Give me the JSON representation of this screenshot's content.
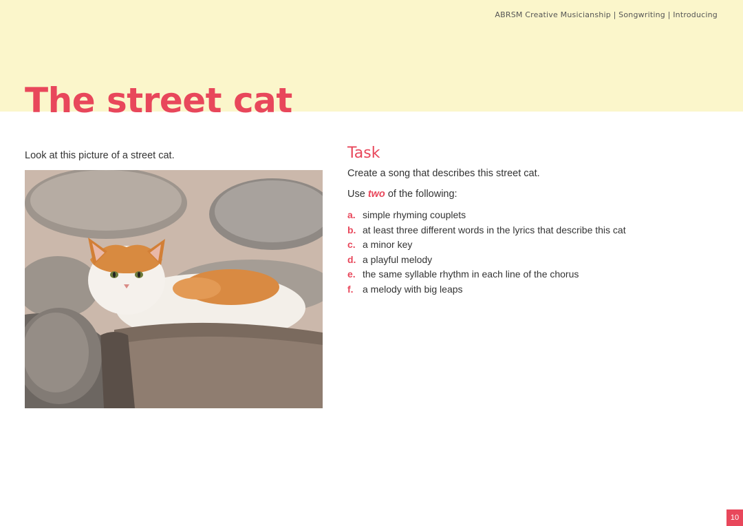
{
  "header": {
    "running_head": "ABRSM Creative Musicianship | Songwriting | Introducing",
    "title": "The street cat"
  },
  "left": {
    "intro": "Look at this picture of a street cat."
  },
  "task": {
    "title": "Task",
    "lead": "Create a song that describes this street cat.",
    "use_prefix": "Use",
    "use_emphasis": "two",
    "use_suffix": "of the following:",
    "options": [
      {
        "letter": "a.",
        "text": "simple rhyming couplets"
      },
      {
        "letter": "b.",
        "text": "at least three different words in the lyrics that describe this cat"
      },
      {
        "letter": "c.",
        "text": "a minor key"
      },
      {
        "letter": "d.",
        "text": "a playful melody"
      },
      {
        "letter": "e.",
        "text": "the same syllable rhythm in each line of the chorus"
      },
      {
        "letter": "f.",
        "text": "a melody with big leaps"
      }
    ]
  },
  "footer": {
    "page_number": "10"
  },
  "colors": {
    "accent": "#e8475b",
    "header_band": "#fbf6cb"
  }
}
